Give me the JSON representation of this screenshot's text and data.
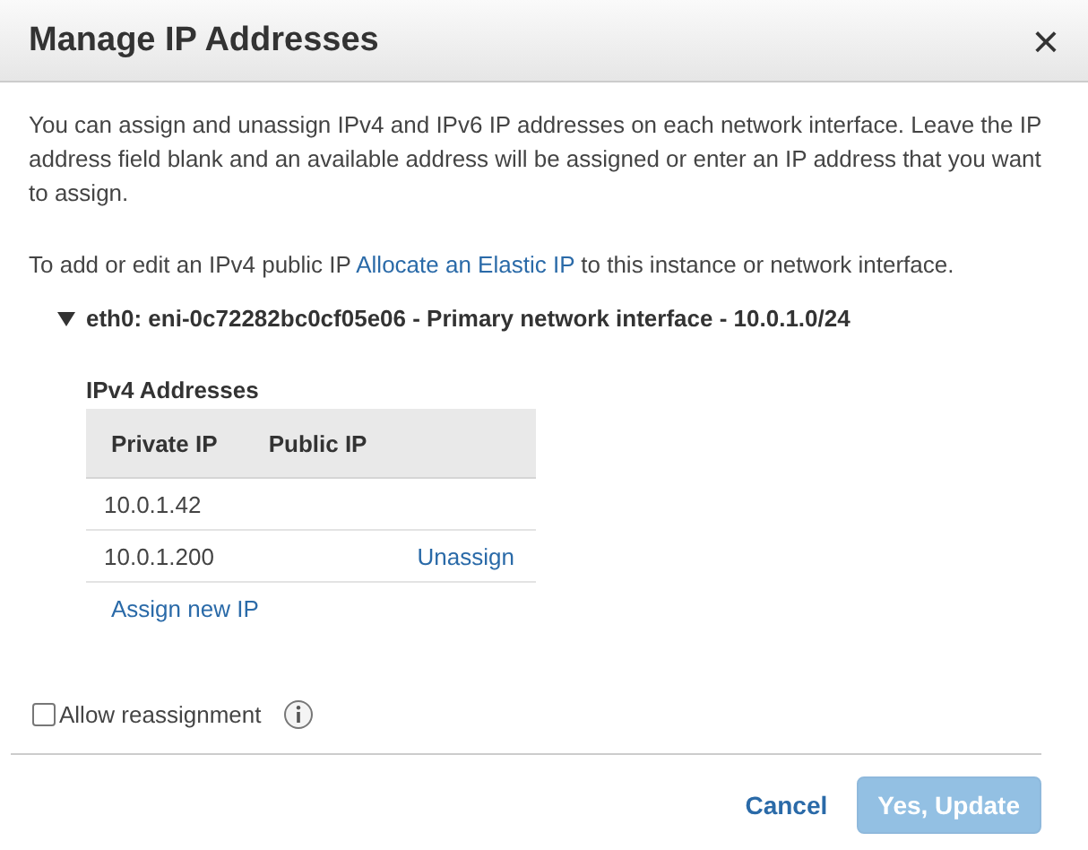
{
  "dialog": {
    "title": "Manage IP Addresses",
    "close": "×"
  },
  "intro": "You can assign and unassign IPv4 and IPv6 IP addresses on each network interface. Leave the IP address field blank and an available address will be assigned or enter an IP address that you want to assign.",
  "elastic": {
    "before": "To add or edit an IPv4 public IP",
    "link": "Allocate an Elastic IP",
    "after": "to this instance or network interface."
  },
  "interface": {
    "label": "eth0: eni-0c72282bc0cf05e06 - Primary network interface - 10.0.1.0/24",
    "expanded": true
  },
  "ipv4": {
    "heading": "IPv4 Addresses",
    "columns": [
      "Private IP",
      "Public IP"
    ],
    "rows": [
      {
        "private_ip": "10.0.1.42"
      },
      {
        "private_ip": "10.0.1.200",
        "action": "Unassign"
      }
    ],
    "add_link": "Assign new IP"
  },
  "reassign": {
    "label": "Allow reassignment",
    "checked": false
  },
  "buttons": {
    "cancel": "Cancel",
    "confirm": {
      "label": "Yes, Update",
      "disabled": true
    }
  }
}
